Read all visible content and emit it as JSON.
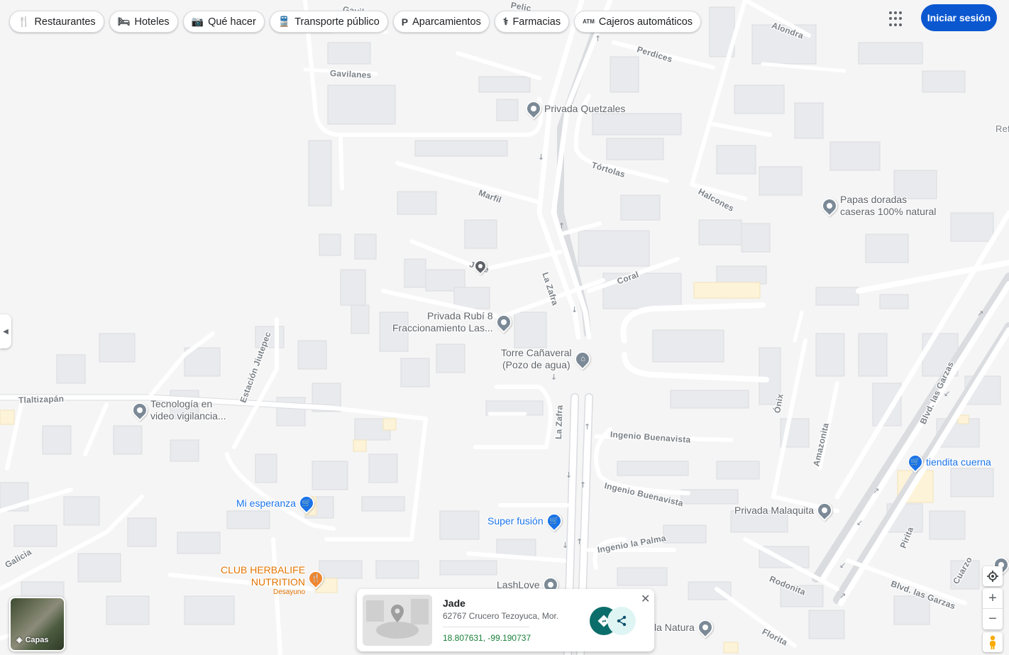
{
  "categories": [
    {
      "label": "Restaurantes",
      "icon": "restaurant-icon",
      "glyph": "🍴"
    },
    {
      "label": "Hoteles",
      "icon": "hotel-bed-icon",
      "glyph": "🛏"
    },
    {
      "label": "Qué hacer",
      "icon": "camera-icon",
      "glyph": "📷"
    },
    {
      "label": "Transporte público",
      "icon": "bus-icon",
      "glyph": "🚆"
    },
    {
      "label": "Aparcamientos",
      "icon": "parking-icon",
      "glyph": "P"
    },
    {
      "label": "Farmacias",
      "icon": "pharmacy-icon",
      "glyph": "⚕"
    },
    {
      "label": "Cajeros automáticos",
      "icon": "atm-icon",
      "glyph": "ATM"
    }
  ],
  "header": {
    "signin_label": "Iniciar sesión",
    "apps_icon": "apps-grid-icon"
  },
  "streets": {
    "gavilanes_top": "Gavilanes",
    "pelicanos": "Pelic",
    "alondra": "Alondra",
    "perdices": "Perdices",
    "gavilanes": "Gavilanes",
    "tortolas": "Tórtolas",
    "halcones": "Halcones",
    "marfil": "Marfil",
    "jade": "Jade",
    "la_zafra_north": "La Zafra",
    "coral": "Coral",
    "tlaltizapan": "Tlaltizapán",
    "estacion_jiutepec": "Estación Jiutepec",
    "la_zafra_south": "La Zafra",
    "ingenio_buenavista_1": "Ingenio Buenavista",
    "ingenio_buenavista_2": "Ingenio Buenavista",
    "ingenio_la_palma": "Ingenio la Palma",
    "onix": "Ónix",
    "amazonita": "Amazonita",
    "blvd_las_garzas_1": "Blvd. las Garzas",
    "blvd_las_garzas_2": "Blvd. las Garzas",
    "pirita": "Pirita",
    "cuarzo": "Cuarzo",
    "rodonita": "Rodonita",
    "florita": "Florita",
    "galicia": "Galicia",
    "ref": "Ref"
  },
  "pois": {
    "privada_quetzales": "Privada Quetzales",
    "papas_doradas": "Papas doradas\ncaseras 100% natural",
    "privada_rubi": "Privada Rubí 8\nFraccionamiento Las...",
    "torre_canaveral": "Torre Cañaveral\n(Pozo de agua)",
    "tecnologia": "Tecnología en\nvideo vigilancia...",
    "mi_esperanza": "Mi esperanza",
    "super_fusion": "Super fusión",
    "tiendita_cuerna": "tiendita cuerna",
    "privada_malaquita": "Privada Malaquita",
    "club_herbalife": "CLUB HERBALIFE\nNUTRITION",
    "club_herbalife_sub": "Desayuno",
    "lashlove": "LashLove",
    "natura": "la Natura"
  },
  "controls": {
    "layers_label": "Capas",
    "zoom_in": "+",
    "zoom_out": "−"
  },
  "place_card": {
    "title": "Jade",
    "address": "62767 Crucero Tezoyuca, Mor.",
    "coords": "18.807631, -99.190737"
  },
  "colors": {
    "accent": "#0b57d0",
    "directions": "#0b6e6a",
    "poi_blue": "#1a73e8",
    "poi_orange": "#e37400"
  }
}
